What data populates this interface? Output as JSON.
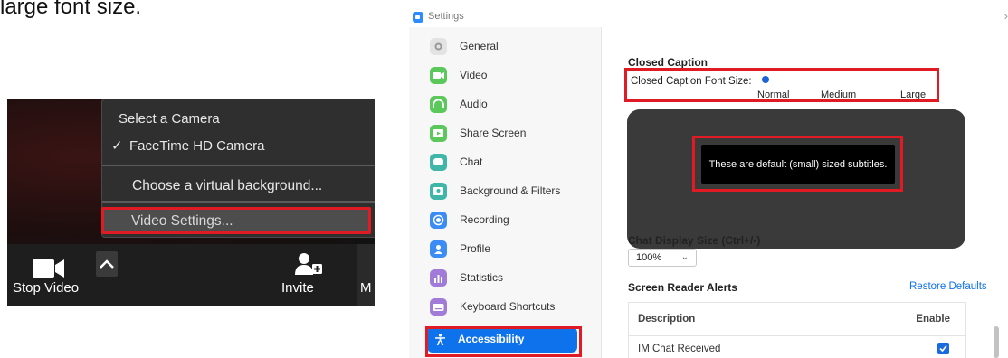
{
  "top_caption": "large font size.",
  "zoom_menu": {
    "heading": "Select a Camera",
    "camera_item": "FaceTime HD Camera",
    "virtual_background_item": "Choose a virtual background...",
    "video_settings_item": "Video Settings..."
  },
  "zoom_toolbar": {
    "stop_video_label": "Stop Video",
    "invite_label": "Invite",
    "cut_off_label": "M"
  },
  "settings": {
    "window_title": "Settings",
    "sidebar": {
      "items": [
        {
          "label": "General",
          "icon": "gear-icon",
          "color": "#e3e3e3"
        },
        {
          "label": "Video",
          "icon": "video-camera-icon",
          "color": "#5ac85a"
        },
        {
          "label": "Audio",
          "icon": "headphones-icon",
          "color": "#5ac85a"
        },
        {
          "label": "Share Screen",
          "icon": "share-screen-icon",
          "color": "#5ac85a"
        },
        {
          "label": "Chat",
          "icon": "chat-bubble-icon",
          "color": "#3fb6a8"
        },
        {
          "label": "Background & Filters",
          "icon": "background-person-icon",
          "color": "#3fb6a8"
        },
        {
          "label": "Recording",
          "icon": "record-icon",
          "color": "#3b8cf4"
        },
        {
          "label": "Profile",
          "icon": "profile-icon",
          "color": "#3b8cf4"
        },
        {
          "label": "Statistics",
          "icon": "statistics-icon",
          "color": "#a07bd8"
        },
        {
          "label": "Keyboard Shortcuts",
          "icon": "keyboard-icon",
          "color": "#a07bd8"
        },
        {
          "label": "Accessibility",
          "icon": "accessibility-icon",
          "color": "#0e72ed",
          "active": true
        }
      ]
    },
    "closed_caption": {
      "section_title": "Closed Caption",
      "font_size_label": "Closed Caption Font Size:",
      "size_options": [
        "Normal",
        "Medium",
        "Large"
      ],
      "selected_size": "Normal",
      "preview_text": "These are default (small) sized subtitles."
    },
    "chat_display": {
      "section_title": "Chat Display Size (Ctrl+/-)",
      "value": "100%"
    },
    "screen_reader": {
      "section_title": "Screen Reader Alerts",
      "restore_label": "Restore Defaults",
      "col_description": "Description",
      "col_enable": "Enable",
      "rows": [
        {
          "label": "IM Chat Received",
          "enabled": true
        }
      ]
    }
  },
  "colors": {
    "accent": "#0e72ed",
    "highlight_outline": "#e01b24"
  }
}
